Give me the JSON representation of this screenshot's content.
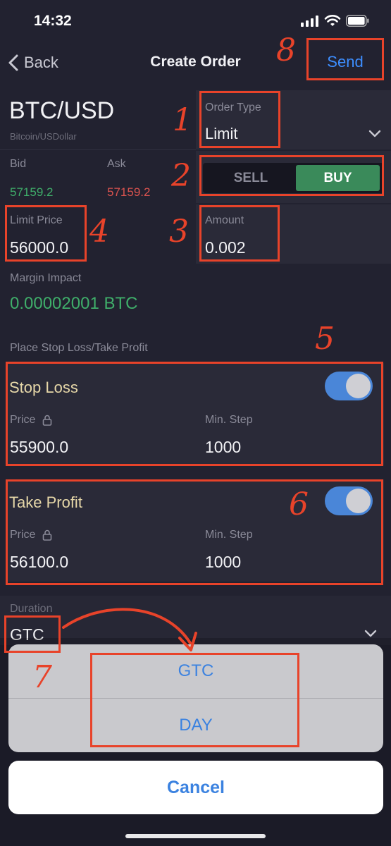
{
  "status_bar": {
    "time": "14:32"
  },
  "nav": {
    "back_label": "Back",
    "title": "Create Order",
    "send_label": "Send"
  },
  "instrument": {
    "symbol": "BTC/USD",
    "description": "Bitcoin/USDollar"
  },
  "order_type": {
    "label": "Order Type",
    "value": "Limit"
  },
  "quotes": {
    "bid_label": "Bid",
    "bid_value": "57159.2",
    "ask_label": "Ask",
    "ask_value": "57159.2"
  },
  "side": {
    "sell_label": "SELL",
    "buy_label": "BUY",
    "selected": "BUY"
  },
  "limit_price": {
    "label": "Limit Price",
    "value": "56000.0"
  },
  "amount": {
    "label": "Amount",
    "value": "0.002"
  },
  "margin": {
    "label": "Margin Impact",
    "value": "0.00002001 BTC"
  },
  "sltp_header": "Place Stop Loss/Take Profit",
  "stop_loss": {
    "title": "Stop Loss",
    "enabled": true,
    "price_label": "Price",
    "price_value": "55900.0",
    "step_label": "Min. Step",
    "step_value": "1000"
  },
  "take_profit": {
    "title": "Take Profit",
    "enabled": true,
    "price_label": "Price",
    "price_value": "56100.0",
    "step_label": "Min. Step",
    "step_value": "1000"
  },
  "duration": {
    "label": "Duration",
    "value": "GTC"
  },
  "action_sheet": {
    "options": [
      "GTC",
      "DAY"
    ],
    "cancel_label": "Cancel"
  },
  "annotations": [
    "1",
    "2",
    "3",
    "4",
    "5",
    "6",
    "7",
    "8"
  ],
  "colors": {
    "bid": "#3fae6a",
    "ask": "#d9534f",
    "accent": "#3d8eff",
    "buy": "#3a8a5a",
    "annotation": "#e8432a",
    "card_title": "#e6d7a8"
  }
}
